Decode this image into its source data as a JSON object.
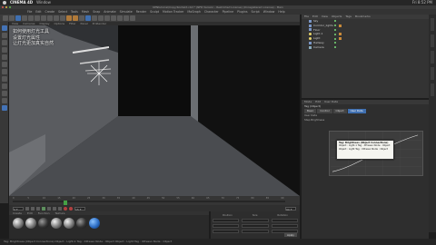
{
  "mac_bar": {
    "app": "CINEMA 4D",
    "window_menu": "Window",
    "clock": "Fri 8:52 PM"
  },
  "window_title": "KENtutorial/Copy/Kontakt.c4d * (NFR Version - Restricted License) (Unregistered License) - Main",
  "menu": [
    "File",
    "Edit",
    "Create",
    "Select",
    "Tools",
    "Mesh",
    "Snap",
    "Animate",
    "Simulate",
    "Render",
    "Sculpt",
    "Motion Tracker",
    "MoGraph",
    "Character",
    "Pipeline",
    "Plugins",
    "Script",
    "Window",
    "Help"
  ],
  "viewport": {
    "menu": [
      "View",
      "Cameras",
      "Display",
      "Options",
      "Filter",
      "Panel",
      "ProRender"
    ],
    "subtitle": [
      "如何使用灯光工具",
      "设置灯光属性",
      "让灯光更加真实自然"
    ]
  },
  "timeline": {
    "ticks": [
      "0",
      "5",
      "10",
      "15",
      "20",
      "25",
      "30",
      "35",
      "40",
      "45",
      "50",
      "55",
      "60",
      "65",
      "70",
      "75",
      "80",
      "85",
      "90"
    ],
    "current_frame": "15 F",
    "start": "0 F",
    "end": "90 F"
  },
  "materials": {
    "menu": [
      "Create",
      "Edit",
      "Function",
      "Texture"
    ]
  },
  "coordinates": {
    "headers": [
      "Position",
      "Size",
      "Rotation"
    ],
    "axes": [
      "X",
      "Y",
      "Z"
    ],
    "apply": "Apply"
  },
  "objects": {
    "menu": [
      "File",
      "Edit",
      "View",
      "Objects",
      "Tags",
      "Bookmarks"
    ],
    "items": [
      {
        "label": "Sky",
        "icon": "sky-icon"
      },
      {
        "label": "Corridor_lights",
        "icon": "null-icon"
      },
      {
        "label": "Floor",
        "icon": "floor-icon"
      },
      {
        "label": "Light.1",
        "icon": "light-icon"
      },
      {
        "label": "Light",
        "icon": "light-icon"
      },
      {
        "label": "Hallway",
        "icon": "object-icon"
      },
      {
        "label": "Camera",
        "icon": "camera-icon"
      }
    ]
  },
  "attributes": {
    "menu": [
      "Mode",
      "Edit",
      "User Data"
    ],
    "title": "Tag (Object)",
    "tabs": [
      "Basic",
      "Control",
      "Object",
      "User Data"
    ],
    "active_tab": "User Data",
    "sub": "User Data",
    "field": "Step Brightness",
    "tooltip": [
      "Tag: Brightness (Object Connections)",
      "Object : Light.1 Tag : XPresso  Node : Object",
      "Object : Light Tag : XPresso  Node : Object"
    ]
  },
  "status": "Tag: Brightness (Object Connections)  Object : Light.1  Tag : XPresso  Node : Object  Object : Light  Tag : XPresso  Node : Object"
}
